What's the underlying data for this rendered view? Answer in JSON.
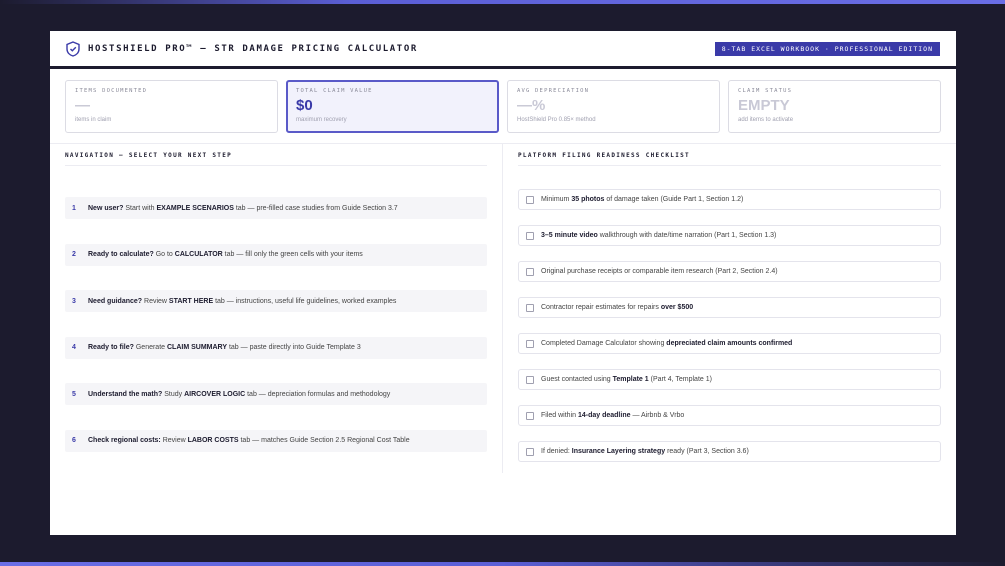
{
  "header": {
    "title": "HOSTSHIELD PRO™ — STR DAMAGE PRICING CALCULATOR",
    "badge": "8-TAB EXCEL WORKBOOK · PROFESSIONAL EDITION",
    "icon": "shield-icon"
  },
  "stats": [
    {
      "label": "ITEMS DOCUMENTED",
      "value": "—",
      "sub": "items in claim"
    },
    {
      "label": "TOTAL CLAIM VALUE",
      "value": "$0",
      "sub": "maximum recovery"
    },
    {
      "label": "AVG DEPRECIATION",
      "value": "—%",
      "sub": "HostShield Pro 0.85× method"
    },
    {
      "label": "CLAIM STATUS",
      "value": "EMPTY",
      "sub": "add items to activate"
    }
  ],
  "navigation": {
    "title": "NAVIGATION — SELECT YOUR NEXT STEP",
    "items": [
      {
        "num": "1",
        "lead": "New user?",
        "pre": " Start with ",
        "key": "EXAMPLE SCENARIOS",
        "post": " tab — pre-filled case studies from Guide Section 3.7"
      },
      {
        "num": "2",
        "lead": "Ready to calculate?",
        "pre": " Go to ",
        "key": "CALCULATOR",
        "post": " tab — fill only the green cells with your items"
      },
      {
        "num": "3",
        "lead": "Need guidance?",
        "pre": " Review ",
        "key": "START HERE",
        "post": " tab — instructions, useful life guidelines, worked examples"
      },
      {
        "num": "4",
        "lead": "Ready to file?",
        "pre": " Generate ",
        "key": "CLAIM SUMMARY",
        "post": " tab — paste directly into Guide Template 3"
      },
      {
        "num": "5",
        "lead": "Understand the math?",
        "pre": " Study ",
        "key": "AIRCOVER LOGIC",
        "post": " tab — depreciation formulas and methodology"
      },
      {
        "num": "6",
        "lead": "Check regional costs:",
        "pre": " Review ",
        "key": "LABOR COSTS",
        "post": " tab — matches Guide Section 2.5 Regional Cost Table"
      }
    ]
  },
  "checklist": {
    "title": "PLATFORM FILING READINESS CHECKLIST",
    "items": [
      {
        "pre": "Minimum ",
        "bold": "35 photos",
        "post": " of damage taken (Guide Part 1, Section 1.2)"
      },
      {
        "pre": "",
        "bold": "3–5 minute video",
        "post": " walkthrough with date/time narration (Part 1, Section 1.3)"
      },
      {
        "pre": "Original purchase receipts or comparable item research (Part 2, Section 2.4)",
        "bold": "",
        "post": ""
      },
      {
        "pre": "Contractor repair estimates for repairs ",
        "bold": "over $500",
        "post": ""
      },
      {
        "pre": "Completed Damage Calculator showing ",
        "bold": "depreciated claim amounts confirmed",
        "post": ""
      },
      {
        "pre": "Guest contacted using ",
        "bold": "Template 1",
        "post": " (Part 4, Template 1)"
      },
      {
        "pre": "Filed within ",
        "bold": "14-day deadline",
        "post": " — Airbnb & Vrbo"
      },
      {
        "pre": "If denied: ",
        "bold": "Insurance Layering strategy",
        "post": " ready (Part 3, Section 3.6)"
      }
    ]
  },
  "colors": {
    "accent": "#3a3aa8",
    "background": "#1c1b2e"
  }
}
